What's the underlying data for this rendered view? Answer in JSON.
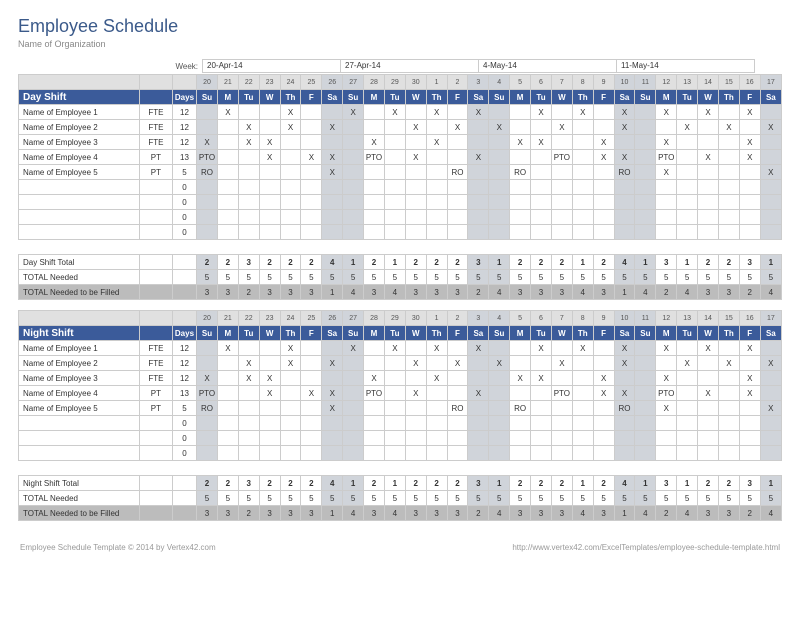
{
  "title": "Employee Schedule",
  "org": "Name of Organization",
  "week_label": "Week:",
  "week_dates": [
    "20-Apr-14",
    "27-Apr-14",
    "4-May-14",
    "11-May-14"
  ],
  "day_nums": [
    20,
    21,
    22,
    23,
    24,
    25,
    26,
    27,
    28,
    29,
    30,
    1,
    2,
    3,
    4,
    5,
    6,
    7,
    8,
    9,
    10,
    11,
    12,
    13,
    14,
    15,
    16,
    17
  ],
  "day_names": [
    "Su",
    "M",
    "Tu",
    "W",
    "Th",
    "F",
    "Sa",
    "Su",
    "M",
    "Tu",
    "W",
    "Th",
    "F",
    "Sa",
    "Su",
    "M",
    "Tu",
    "W",
    "Th",
    "F",
    "Sa",
    "Su",
    "M",
    "Tu",
    "W",
    "Th",
    "F",
    "Sa"
  ],
  "weekend_idx": [
    0,
    6,
    7,
    13,
    14,
    20,
    21,
    27
  ],
  "days_header": "Days",
  "shifts": [
    {
      "name": "Day Shift",
      "total_label": "Day Shift Total",
      "employees": [
        {
          "name": "Name of Employee 1",
          "type": "FTE",
          "days": 12,
          "marks": [
            "",
            "X",
            "",
            "",
            "X",
            "",
            "",
            "X",
            "",
            "X",
            "",
            "X",
            "",
            "X",
            "",
            "",
            "X",
            "",
            "X",
            "",
            "X",
            "",
            "X",
            "",
            "X",
            "",
            "X",
            ""
          ]
        },
        {
          "name": "Name of Employee 2",
          "type": "FTE",
          "days": 12,
          "marks": [
            "",
            "",
            "X",
            "",
            "X",
            "",
            "X",
            "",
            "",
            "",
            "X",
            "",
            "X",
            "",
            "X",
            "",
            "",
            "X",
            "",
            "",
            "X",
            "",
            "",
            "X",
            "",
            "X",
            "",
            "X"
          ]
        },
        {
          "name": "Name of Employee 3",
          "type": "FTE",
          "days": 12,
          "marks": [
            "X",
            "",
            "X",
            "X",
            "",
            "",
            "",
            "",
            "X",
            "",
            "",
            "X",
            "",
            "",
            "",
            "X",
            "X",
            "",
            "",
            "X",
            "",
            "",
            "X",
            "",
            "",
            "",
            "X",
            ""
          ]
        },
        {
          "name": "Name of Employee 4",
          "type": "PT",
          "days": 13,
          "marks": [
            "PTO",
            "",
            "",
            "X",
            "",
            "X",
            "X",
            "",
            "PTO",
            "",
            "X",
            "",
            "",
            "X",
            "",
            "",
            "",
            "PTO",
            "",
            "X",
            "X",
            "",
            "PTO",
            "",
            "X",
            "",
            "X",
            ""
          ]
        },
        {
          "name": "Name of Employee 5",
          "type": "PT",
          "days": 5,
          "marks": [
            "RO",
            "",
            "",
            "",
            "",
            "",
            "X",
            "",
            "",
            "",
            "",
            "",
            "RO",
            "",
            "",
            "RO",
            "",
            "",
            "",
            "",
            "RO",
            "",
            "X",
            "",
            "",
            "",
            "",
            "X"
          ]
        }
      ],
      "blank_days": [
        0,
        0,
        0,
        0
      ],
      "totals": [
        2,
        2,
        3,
        2,
        2,
        2,
        4,
        1,
        2,
        1,
        2,
        2,
        2,
        3,
        1,
        2,
        2,
        2,
        1,
        2,
        4,
        1,
        3,
        1,
        2,
        2,
        3,
        1
      ],
      "needed": [
        5,
        5,
        5,
        5,
        5,
        5,
        5,
        5,
        5,
        5,
        5,
        5,
        5,
        5,
        5,
        5,
        5,
        5,
        5,
        5,
        5,
        5,
        5,
        5,
        5,
        5,
        5,
        5
      ],
      "fill": [
        3,
        3,
        2,
        3,
        3,
        3,
        1,
        4,
        3,
        4,
        3,
        3,
        3,
        2,
        4,
        3,
        3,
        3,
        4,
        3,
        1,
        4,
        2,
        4,
        3,
        3,
        2,
        4
      ]
    },
    {
      "name": "Night Shift",
      "total_label": "Night Shift Total",
      "employees": [
        {
          "name": "Name of Employee 1",
          "type": "FTE",
          "days": 12,
          "marks": [
            "",
            "X",
            "",
            "",
            "X",
            "",
            "",
            "X",
            "",
            "X",
            "",
            "X",
            "",
            "X",
            "",
            "",
            "X",
            "",
            "X",
            "",
            "X",
            "",
            "X",
            "",
            "X",
            "",
            "X",
            ""
          ]
        },
        {
          "name": "Name of Employee 2",
          "type": "FTE",
          "days": 12,
          "marks": [
            "",
            "",
            "X",
            "",
            "X",
            "",
            "X",
            "",
            "",
            "",
            "X",
            "",
            "X",
            "",
            "X",
            "",
            "",
            "X",
            "",
            "",
            "X",
            "",
            "",
            "X",
            "",
            "X",
            "",
            "X"
          ]
        },
        {
          "name": "Name of Employee 3",
          "type": "FTE",
          "days": 12,
          "marks": [
            "X",
            "",
            "X",
            "X",
            "",
            "",
            "",
            "",
            "X",
            "",
            "",
            "X",
            "",
            "",
            "",
            "X",
            "X",
            "",
            "",
            "X",
            "",
            "",
            "X",
            "",
            "",
            "",
            "X",
            ""
          ]
        },
        {
          "name": "Name of Employee 4",
          "type": "PT",
          "days": 13,
          "marks": [
            "PTO",
            "",
            "",
            "X",
            "",
            "X",
            "X",
            "",
            "PTO",
            "",
            "X",
            "",
            "",
            "X",
            "",
            "",
            "",
            "PTO",
            "",
            "X",
            "X",
            "",
            "PTO",
            "",
            "X",
            "",
            "X",
            ""
          ]
        },
        {
          "name": "Name of Employee 5",
          "type": "PT",
          "days": 5,
          "marks": [
            "RO",
            "",
            "",
            "",
            "",
            "",
            "X",
            "",
            "",
            "",
            "",
            "",
            "RO",
            "",
            "",
            "RO",
            "",
            "",
            "",
            "",
            "RO",
            "",
            "X",
            "",
            "",
            "",
            "",
            "X"
          ]
        }
      ],
      "blank_days": [
        0,
        0,
        0
      ],
      "totals": [
        2,
        2,
        3,
        2,
        2,
        2,
        4,
        1,
        2,
        1,
        2,
        2,
        2,
        3,
        1,
        2,
        2,
        2,
        1,
        2,
        4,
        1,
        3,
        1,
        2,
        2,
        3,
        1
      ],
      "needed": [
        5,
        5,
        5,
        5,
        5,
        5,
        5,
        5,
        5,
        5,
        5,
        5,
        5,
        5,
        5,
        5,
        5,
        5,
        5,
        5,
        5,
        5,
        5,
        5,
        5,
        5,
        5,
        5
      ],
      "fill": [
        3,
        3,
        2,
        3,
        3,
        3,
        1,
        4,
        3,
        4,
        3,
        3,
        3,
        2,
        4,
        3,
        3,
        3,
        4,
        3,
        1,
        4,
        2,
        4,
        3,
        3,
        2,
        4
      ]
    }
  ],
  "total_needed_label": "TOTAL Needed",
  "fill_label": "TOTAL Needed to be Filled",
  "footer_left": "Employee Schedule Template © 2014 by Vertex42.com",
  "footer_right": "http://www.vertex42.com/ExcelTemplates/employee-schedule-template.html"
}
